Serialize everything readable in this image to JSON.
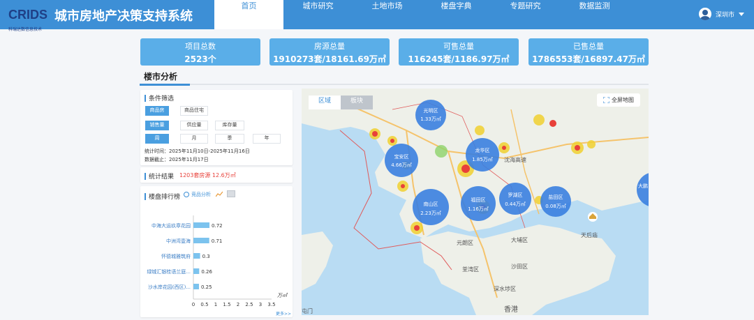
{
  "header": {
    "logo_text": "CRIDS",
    "logo_sub": "科瑞达数信息技术",
    "title": "城市房地产决策支持系统",
    "nav": [
      "首页",
      "城市研究",
      "土地市场",
      "楼盘字典",
      "专题研究",
      "数据监测"
    ],
    "active_nav": "首页",
    "user_city": "深圳市"
  },
  "stats": [
    {
      "label": "项目总数",
      "value": "2523个"
    },
    {
      "label": "房源总量",
      "value": "1910273套/18161.69万㎡"
    },
    {
      "label": "可售总量",
      "value": "116245套/1186.97万㎡"
    },
    {
      "label": "已售总量",
      "value": "1786553套/16897.47万㎡"
    }
  ],
  "section_title": "楼市分析",
  "filters": {
    "title": "条件筛选",
    "row1": [
      "商品房",
      "商品住宅"
    ],
    "row2": [
      "销售量",
      "供应量",
      "库存量"
    ],
    "row3": [
      "周",
      "月",
      "季",
      "年"
    ],
    "stat_time": "统计时间：2025年11月10日-2025年11月16日",
    "data_end": "数据截止：2025年11月17日"
  },
  "result": {
    "label": "统计结果",
    "value": "1203套房源 12.6万㎡"
  },
  "ranking": {
    "title": "楼盘排行榜",
    "tab_link": "竞品分析",
    "more": "更多>>",
    "unit": "万㎡"
  },
  "chart_data": {
    "type": "bar",
    "orientation": "horizontal",
    "categories": [
      "中海大运玖章花园",
      "中洲湾壹海",
      "怀德城雅筑府",
      "绿城汇银桂语兰庭...",
      "沙水岸花园(西区)..."
    ],
    "values": [
      0.72,
      0.71,
      0.3,
      0.26,
      0.25
    ],
    "xlim": [
      0,
      3.5
    ],
    "xticks": [
      "0",
      "0.5",
      "1",
      "1.5",
      "2",
      "2.5",
      "3",
      "3.5"
    ],
    "xlabel": "万㎡",
    "color": "#7cc3ee"
  },
  "map": {
    "tabs": [
      "区域",
      "板块"
    ],
    "full_label": "全屏地图",
    "bubbles": [
      {
        "name": "光明区",
        "value": "1.33万㎡"
      },
      {
        "name": "宝安区",
        "value": "4.66万㎡"
      },
      {
        "name": "龙华区",
        "value": "1.85万㎡"
      },
      {
        "name": "南山区",
        "value": "2.23万㎡"
      },
      {
        "name": "福田区",
        "value": "1.16万㎡"
      },
      {
        "name": "罗湖区",
        "value": "0.44万㎡"
      },
      {
        "name": "盐田区",
        "value": "0.08万㎡"
      },
      {
        "name": "大鹏",
        "value": ""
      }
    ],
    "places": [
      "元朗区",
      "大埔区",
      "沙田区",
      "香港",
      "深水埗区",
      "荃湾区",
      "天后庙",
      "沈海高速",
      "屯门"
    ]
  },
  "colors": {
    "primary": "#3d8fd6",
    "stat_bg": "#5aaee8",
    "bubble": "#3a7fe0",
    "accent_red": "#e8413a"
  }
}
